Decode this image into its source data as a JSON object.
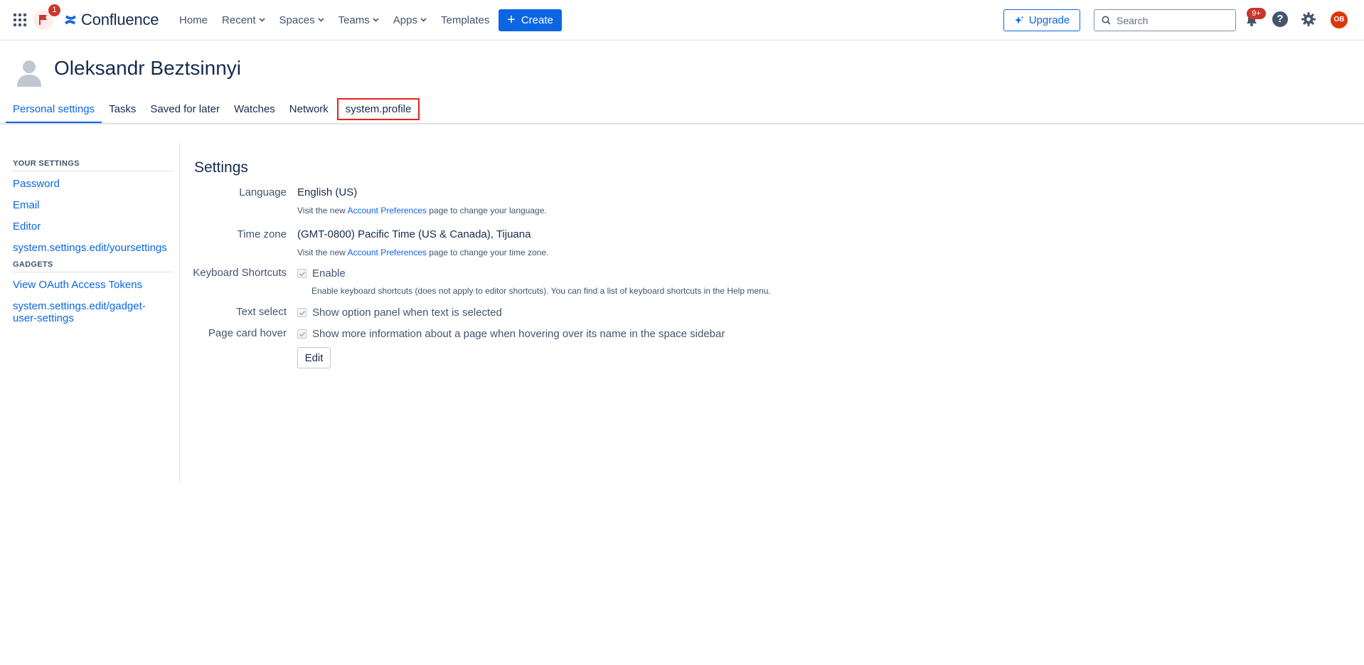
{
  "topnav": {
    "flag_badge": "1",
    "logo_text": "Confluence",
    "nav_items": [
      "Home",
      "Recent",
      "Spaces",
      "Teams",
      "Apps",
      "Templates"
    ],
    "create_label": "Create",
    "upgrade_label": "Upgrade",
    "search": {
      "placeholder": "Search",
      "value": ""
    },
    "notifications_badge": "9+",
    "help_label": "?",
    "avatar_initials": "OB"
  },
  "profile": {
    "name": "Oleksandr Beztsinnyi"
  },
  "tabs": [
    {
      "label": "Personal settings",
      "active": true
    },
    {
      "label": "Tasks"
    },
    {
      "label": "Saved for later"
    },
    {
      "label": "Watches"
    },
    {
      "label": "Network"
    },
    {
      "label": "system.profile",
      "outlined": true
    }
  ],
  "sidebar": {
    "your_settings_heading": "YOUR SETTINGS",
    "your_settings": [
      "Password",
      "Email",
      "Editor",
      "system.settings.edit/yoursettings"
    ],
    "gadgets_heading": "GADGETS",
    "gadgets": [
      "View OAuth Access Tokens",
      "system.settings.edit/gadget-user-settings"
    ]
  },
  "settings": {
    "title": "Settings",
    "language": {
      "label": "Language",
      "value": "English (US)",
      "hint_before": "Visit the new ",
      "hint_link": "Account Preferences",
      "hint_after": " page to change your language."
    },
    "timezone": {
      "label": "Time zone",
      "value": "(GMT-0800) Pacific Time (US & Canada), Tijuana",
      "hint_before": "Visit the new ",
      "hint_link": "Account Preferences",
      "hint_after": " page to change your time zone."
    },
    "keyboard": {
      "label": "Keyboard Shortcuts",
      "checkbox_label": "Enable",
      "hint": "Enable keyboard shortcuts (does not apply to editor shortcuts). You can find a list of keyboard shortcuts in the Help menu."
    },
    "text_select": {
      "label": "Text select",
      "checkbox_label": "Show option panel when text is selected"
    },
    "page_card_hover": {
      "label": "Page card hover",
      "checkbox_label": "Show more information about a page when hovering over its name in the space sidebar"
    },
    "edit_label": "Edit"
  }
}
